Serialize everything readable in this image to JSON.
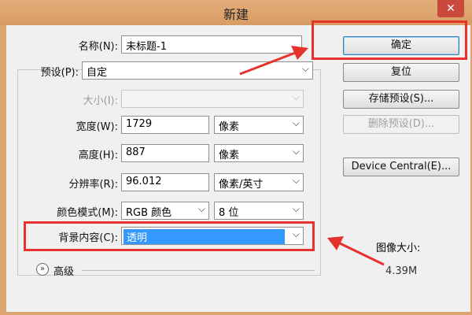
{
  "window": {
    "title": "新建",
    "close_glyph": "✕"
  },
  "form": {
    "name": {
      "label": "名称(N):",
      "value": "未标题-1"
    },
    "preset": {
      "label": "预设(P):",
      "value": "自定"
    },
    "size": {
      "label": "大小(I):",
      "value": ""
    },
    "width": {
      "label": "宽度(W):",
      "value": "1729",
      "unit": "像素"
    },
    "height": {
      "label": "高度(H):",
      "value": "887",
      "unit": "像素"
    },
    "resolution": {
      "label": "分辨率(R):",
      "value": "96.012",
      "unit": "像素/英寸"
    },
    "color_mode": {
      "label": "颜色模式(M):",
      "value": "RGB 颜色",
      "depth": "8 位"
    },
    "background": {
      "label": "背景内容(C):",
      "value": "透明"
    },
    "advanced": {
      "label": "高级"
    }
  },
  "buttons": {
    "ok": "确定",
    "reset": "复位",
    "save_preset": "存储预设(S)...",
    "delete_preset": "删除预设(D)...",
    "device_central": "Device Central(E)..."
  },
  "image_size": {
    "label": "图像大小:",
    "value": "4.39M"
  },
  "icons": {
    "dropdown": "chevron-down-icon",
    "advanced": "double-chevron-down-icon",
    "arrow": "red-arrow-annotation"
  },
  "colors": {
    "window_frame": "#dca470",
    "annotation": "#e5322d",
    "selection": "#3399ff"
  }
}
